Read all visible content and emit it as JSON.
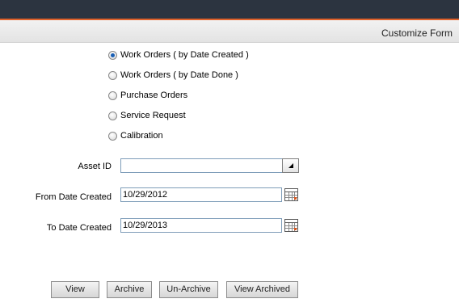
{
  "header": {
    "title": "Customize Form"
  },
  "report_types": [
    {
      "label": "Work Orders ( by Date Created )",
      "checked": true
    },
    {
      "label": "Work Orders ( by Date Done )",
      "checked": false
    },
    {
      "label": "Purchase Orders",
      "checked": false
    },
    {
      "label": "Service Request",
      "checked": false
    },
    {
      "label": "Calibration",
      "checked": false
    }
  ],
  "fields": {
    "asset_id": {
      "label": "Asset ID",
      "value": ""
    },
    "from_date": {
      "label": "From Date Created",
      "value": "10/29/2012"
    },
    "to_date": {
      "label": "To Date Created",
      "value": "10/29/2013"
    }
  },
  "buttons": {
    "view": "View",
    "archive": "Archive",
    "unarchive": "Un-Archive",
    "view_archived": "View Archived"
  },
  "colors": {
    "top_bar": "#2c3440",
    "accent_stripe": "#e0622b"
  },
  "icons": {
    "dropdown": "dropdown-arrow-icon",
    "calendar": "calendar-icon"
  }
}
